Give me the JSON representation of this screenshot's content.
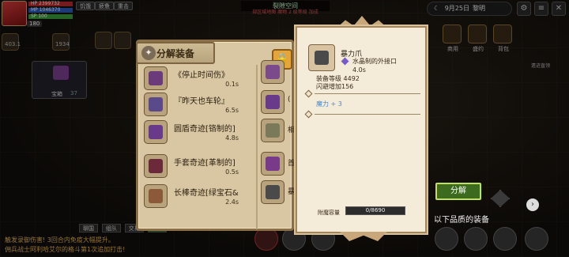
{
  "hud": {
    "level": "180",
    "hp": "2399732",
    "mp": "1046370",
    "sp": "100",
    "status_chips": [
      "饥饿",
      "疲惫",
      "重击"
    ],
    "stat_counts": [
      "403.1",
      "1934"
    ],
    "zone_name": "裂隙空间",
    "zone_sub": "部区域地图 魔物 2 级等级 加成",
    "date": "9月25日",
    "time_of_day": "黎明"
  },
  "side": {
    "chest_label": "宝箱",
    "chest_count": "37"
  },
  "right_menu": {
    "labels": [
      "商用",
      "盛约",
      "背包"
    ],
    "tip": "遗迹直领"
  },
  "chat": {
    "tabs": [
      "聊国",
      "组队",
      "交易",
      "魔法"
    ],
    "lines": [
      "触发录御伤害! 3回合内免疫大幅提升。",
      "佣兵战士阿利哈艾尔的格斗第1次追加打击!"
    ]
  },
  "decompose": {
    "title": "分解装备",
    "items": [
      {
        "name": "《停止时间伤》",
        "time": "0.1s",
        "color": "#6a3a7a"
      },
      {
        "name": "『昨天也车轮』",
        "time": "6.5s",
        "color": "#5a4a8a"
      },
      {
        "name": "圆盾奇迹[铬制的]",
        "time": "4.8s",
        "color": "#6a3a8a"
      },
      {
        "name": "手套奇迹[革制的]",
        "time": "0.5s",
        "color": "#6a2a3a"
      },
      {
        "name": "长棒奇迹[绿宝石&",
        "time": "2.4s",
        "color": "#8a5a3a"
      }
    ],
    "partial_items": [
      {
        "char": "",
        "color": "#7a4a8a"
      },
      {
        "char": "(",
        "color": "#6a3a8a"
      },
      {
        "char": "相",
        "color": "#7a7a5a"
      },
      {
        "char": "首",
        "color": "#7a3a8a"
      },
      {
        "char": "暴",
        "color": "#4a4a4a"
      }
    ]
  },
  "tooltip": {
    "item_name": "暴力爪",
    "socket": "水晶制的外接口",
    "cooldown": "4.0s",
    "equip_level": "装备等级 4492",
    "dodge": "闪避增加156",
    "magic": "魔力 + 3",
    "capacity_label": "附魔容量",
    "capacity_text": "0/8690",
    "capacity_fraction": 0.0
  },
  "actions": {
    "decompose_label": "分解",
    "quality_text": "以下品质的装备"
  }
}
